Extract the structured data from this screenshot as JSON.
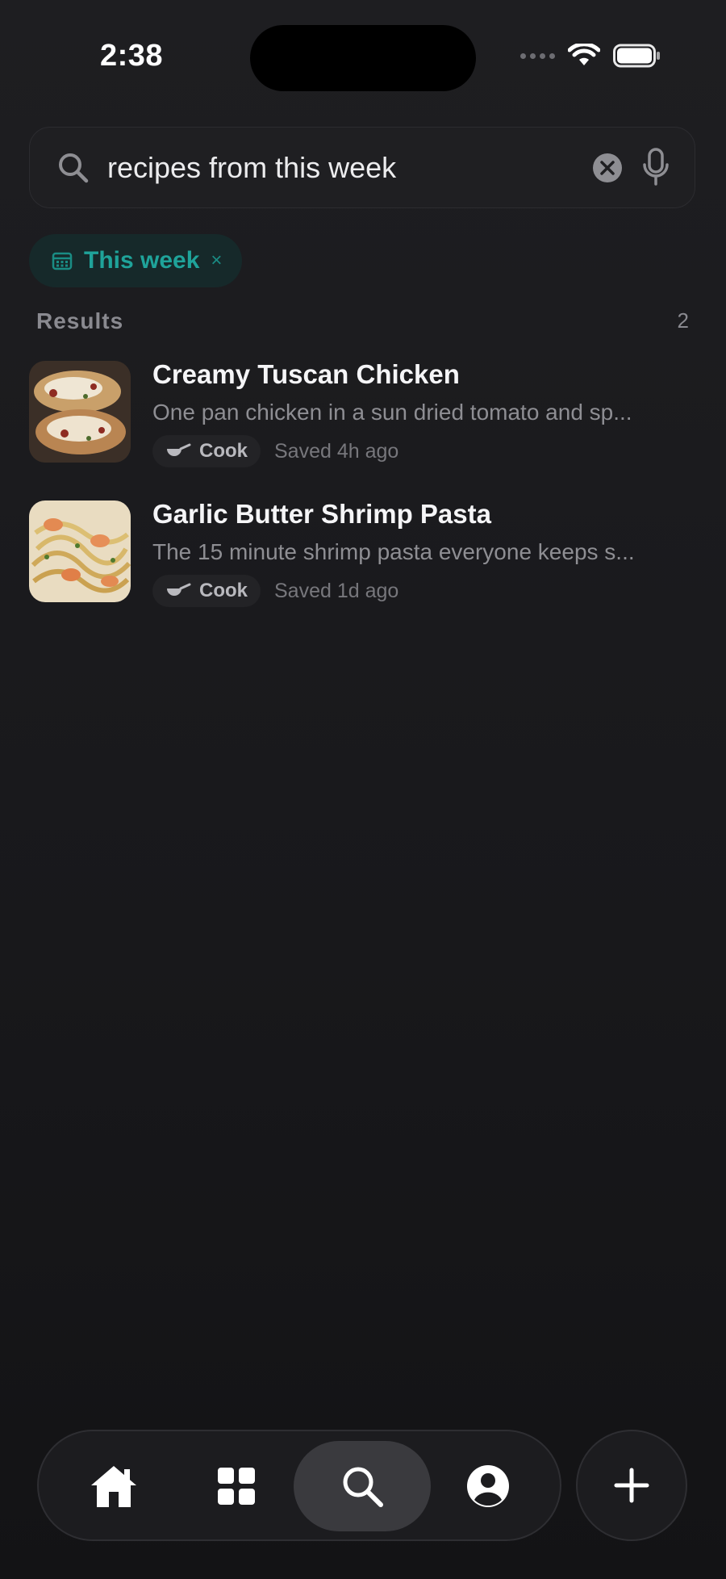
{
  "status": {
    "time": "2:38"
  },
  "search": {
    "value": "recipes from this week",
    "placeholder": "Search"
  },
  "filters": [
    {
      "label": "This week",
      "close": "×"
    }
  ],
  "results": {
    "label": "Results",
    "count": "2",
    "items": [
      {
        "title": "Creamy Tuscan Chicken",
        "description": "One pan chicken in a sun dried tomato and sp...",
        "badge": "Cook",
        "saved": "Saved 4h ago"
      },
      {
        "title": "Garlic Butter Shrimp Pasta",
        "description": "The 15 minute shrimp pasta everyone keeps s...",
        "badge": "Cook",
        "saved": "Saved 1d ago"
      }
    ]
  },
  "nav": {
    "tabs": [
      {
        "icon": "home-icon",
        "active": false
      },
      {
        "icon": "grid-icon",
        "active": false
      },
      {
        "icon": "search-icon",
        "active": true
      },
      {
        "icon": "profile-icon",
        "active": false
      }
    ],
    "add_icon": "plus-icon"
  },
  "colors": {
    "accent": "#1fa39a",
    "chip_bg": "#16292a",
    "background": "#1a1a1d"
  }
}
